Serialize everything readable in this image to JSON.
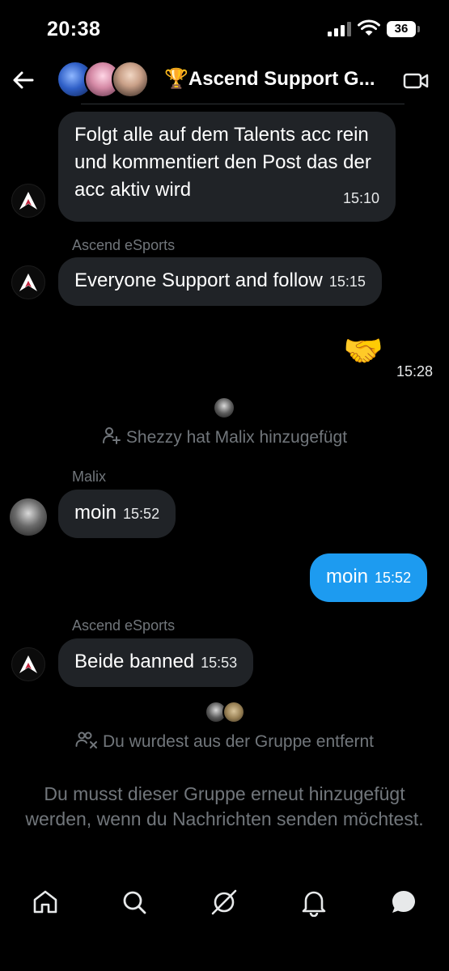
{
  "status_bar": {
    "time": "20:38",
    "battery": "36"
  },
  "header": {
    "title": "🏆Ascend Support G..."
  },
  "messages": [
    {
      "text": "Folgt alle auf dem Talents acc rein und kommentiert den Post das der acc aktiv wird",
      "time": "15:10"
    },
    {
      "sender": "Ascend eSports",
      "text": "Everyone Support and follow",
      "time": "15:15"
    },
    {
      "text": "🤝",
      "time": "15:28"
    },
    {
      "sender": "Malix",
      "text": "moin",
      "time": "15:52"
    },
    {
      "text": "moin",
      "time": "15:52"
    },
    {
      "sender": "Ascend eSports",
      "text": "Beide banned",
      "time": "15:53"
    }
  ],
  "system_events": [
    {
      "text": "Shezzy hat Malix hinzugefügt",
      "icon": "person-add-icon"
    },
    {
      "text": "Du wurdest aus der Gruppe entfernt",
      "icon": "people-remove-icon"
    }
  ],
  "notice": "Du musst dieser Gruppe erneut hinzugefügt werden, wenn du Nachrichten senden möchtest.",
  "nav": [
    "home-icon",
    "search-icon",
    "grok-icon",
    "notifications-icon",
    "messages-icon"
  ],
  "colors": {
    "accent": "#1d9bf0",
    "bubble": "#202327",
    "muted": "#71767b",
    "background": "#000000"
  }
}
